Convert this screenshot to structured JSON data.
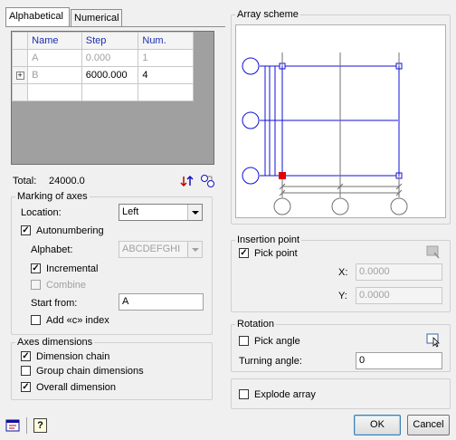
{
  "tabs": [
    {
      "label": "Alphabetical"
    },
    {
      "label": "Numerical"
    }
  ],
  "grid": {
    "columns": [
      "Name",
      "Step",
      "Num."
    ],
    "rows": [
      {
        "name": "A",
        "step": "0.000",
        "num": "1",
        "disabled": true
      },
      {
        "name": "B",
        "step": "6000.000",
        "num": "4",
        "disabled": false
      }
    ]
  },
  "total": {
    "label": "Total:",
    "value": "24000.0"
  },
  "marking": {
    "title": "Marking of axes",
    "location_label": "Location:",
    "location_value": "Left",
    "autonumbering": "Autonumbering",
    "alphabet_label": "Alphabet:",
    "alphabet_value": "ABCDEFGHI",
    "incremental": "Incremental",
    "combine": "Combine",
    "start_from_label": "Start from:",
    "start_from_value": "A",
    "add_index": "Add «c» index"
  },
  "dimensions": {
    "title": "Axes dimensions",
    "dimension_chain": "Dimension chain",
    "group_chain": "Group chain dimensions",
    "overall": "Overall dimension"
  },
  "array_scheme": {
    "title": "Array scheme"
  },
  "insertion": {
    "title": "Insertion point",
    "pick_point": "Pick point",
    "x_label": "X:",
    "x_value": "0.0000",
    "y_label": "Y:",
    "y_value": "0.0000"
  },
  "rotation": {
    "title": "Rotation",
    "pick_angle": "Pick angle",
    "turning_label": "Turning angle:",
    "turning_value": "0"
  },
  "explode": "Explode array",
  "buttons": {
    "ok": "OK",
    "cancel": "Cancel"
  },
  "check_mark": "✓",
  "icons": {
    "help": "?",
    "expand": "+"
  },
  "colors": {
    "axis_blue": "#1010d8",
    "marker_red": "#e00000"
  }
}
